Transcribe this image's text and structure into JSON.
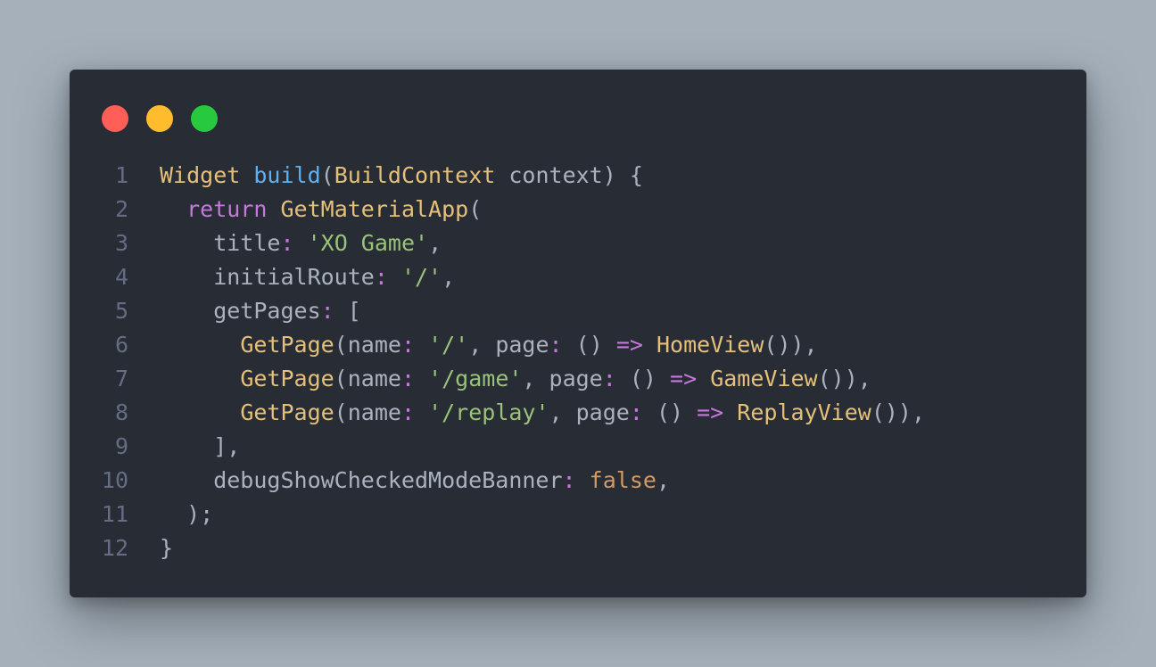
{
  "editor": {
    "window_controls": {
      "close_color": "#ff5f56",
      "minimize_color": "#ffbd2e",
      "maximize_color": "#27c93f"
    },
    "theme": {
      "background": "#282c34",
      "keyword": "#c678dd",
      "type": "#e5c07b",
      "function": "#61afef",
      "string": "#98c379",
      "literal": "#d19a66",
      "plain": "#abb2bf",
      "line_number": "#636d83"
    },
    "lines": [
      {
        "number": "1",
        "tokens": [
          {
            "t": "Widget",
            "c": "ty"
          },
          {
            "t": " ",
            "c": "pl"
          },
          {
            "t": "build",
            "c": "fn"
          },
          {
            "t": "(",
            "c": "pl"
          },
          {
            "t": "BuildContext",
            "c": "ty"
          },
          {
            "t": " context) {",
            "c": "pl"
          }
        ]
      },
      {
        "number": "2",
        "tokens": [
          {
            "t": "  ",
            "c": "pl"
          },
          {
            "t": "return",
            "c": "kw"
          },
          {
            "t": " ",
            "c": "pl"
          },
          {
            "t": "GetMaterialApp",
            "c": "ty"
          },
          {
            "t": "(",
            "c": "pl"
          }
        ]
      },
      {
        "number": "3",
        "tokens": [
          {
            "t": "    title",
            "c": "pl"
          },
          {
            "t": ":",
            "c": "kw"
          },
          {
            "t": " ",
            "c": "pl"
          },
          {
            "t": "'XO Game'",
            "c": "str"
          },
          {
            "t": ",",
            "c": "pl"
          }
        ]
      },
      {
        "number": "4",
        "tokens": [
          {
            "t": "    initialRoute",
            "c": "pl"
          },
          {
            "t": ":",
            "c": "kw"
          },
          {
            "t": " ",
            "c": "pl"
          },
          {
            "t": "'/'",
            "c": "str"
          },
          {
            "t": ",",
            "c": "pl"
          }
        ]
      },
      {
        "number": "5",
        "tokens": [
          {
            "t": "    getPages",
            "c": "pl"
          },
          {
            "t": ":",
            "c": "kw"
          },
          {
            "t": " [",
            "c": "pl"
          }
        ]
      },
      {
        "number": "6",
        "tokens": [
          {
            "t": "      ",
            "c": "pl"
          },
          {
            "t": "GetPage",
            "c": "ty"
          },
          {
            "t": "(name",
            "c": "pl"
          },
          {
            "t": ":",
            "c": "kw"
          },
          {
            "t": " ",
            "c": "pl"
          },
          {
            "t": "'/'",
            "c": "str"
          },
          {
            "t": ", page",
            "c": "pl"
          },
          {
            "t": ":",
            "c": "kw"
          },
          {
            "t": " () ",
            "c": "pl"
          },
          {
            "t": "=>",
            "c": "kw"
          },
          {
            "t": " ",
            "c": "pl"
          },
          {
            "t": "HomeView",
            "c": "ty"
          },
          {
            "t": "()),",
            "c": "pl"
          }
        ]
      },
      {
        "number": "7",
        "tokens": [
          {
            "t": "      ",
            "c": "pl"
          },
          {
            "t": "GetPage",
            "c": "ty"
          },
          {
            "t": "(name",
            "c": "pl"
          },
          {
            "t": ":",
            "c": "kw"
          },
          {
            "t": " ",
            "c": "pl"
          },
          {
            "t": "'/game'",
            "c": "str"
          },
          {
            "t": ", page",
            "c": "pl"
          },
          {
            "t": ":",
            "c": "kw"
          },
          {
            "t": " () ",
            "c": "pl"
          },
          {
            "t": "=>",
            "c": "kw"
          },
          {
            "t": " ",
            "c": "pl"
          },
          {
            "t": "GameView",
            "c": "ty"
          },
          {
            "t": "()),",
            "c": "pl"
          }
        ]
      },
      {
        "number": "8",
        "tokens": [
          {
            "t": "      ",
            "c": "pl"
          },
          {
            "t": "GetPage",
            "c": "ty"
          },
          {
            "t": "(name",
            "c": "pl"
          },
          {
            "t": ":",
            "c": "kw"
          },
          {
            "t": " ",
            "c": "pl"
          },
          {
            "t": "'/replay'",
            "c": "str"
          },
          {
            "t": ", page",
            "c": "pl"
          },
          {
            "t": ":",
            "c": "kw"
          },
          {
            "t": " () ",
            "c": "pl"
          },
          {
            "t": "=>",
            "c": "kw"
          },
          {
            "t": " ",
            "c": "pl"
          },
          {
            "t": "ReplayView",
            "c": "ty"
          },
          {
            "t": "()),",
            "c": "pl"
          }
        ]
      },
      {
        "number": "9",
        "tokens": [
          {
            "t": "    ],",
            "c": "pl"
          }
        ]
      },
      {
        "number": "10",
        "tokens": [
          {
            "t": "    debugShowCheckedModeBanner",
            "c": "pl"
          },
          {
            "t": ":",
            "c": "kw"
          },
          {
            "t": " ",
            "c": "pl"
          },
          {
            "t": "false",
            "c": "num"
          },
          {
            "t": ",",
            "c": "pl"
          }
        ]
      },
      {
        "number": "11",
        "tokens": [
          {
            "t": "  );",
            "c": "pl"
          }
        ]
      },
      {
        "number": "12",
        "tokens": [
          {
            "t": "}",
            "c": "pl"
          }
        ]
      }
    ]
  }
}
